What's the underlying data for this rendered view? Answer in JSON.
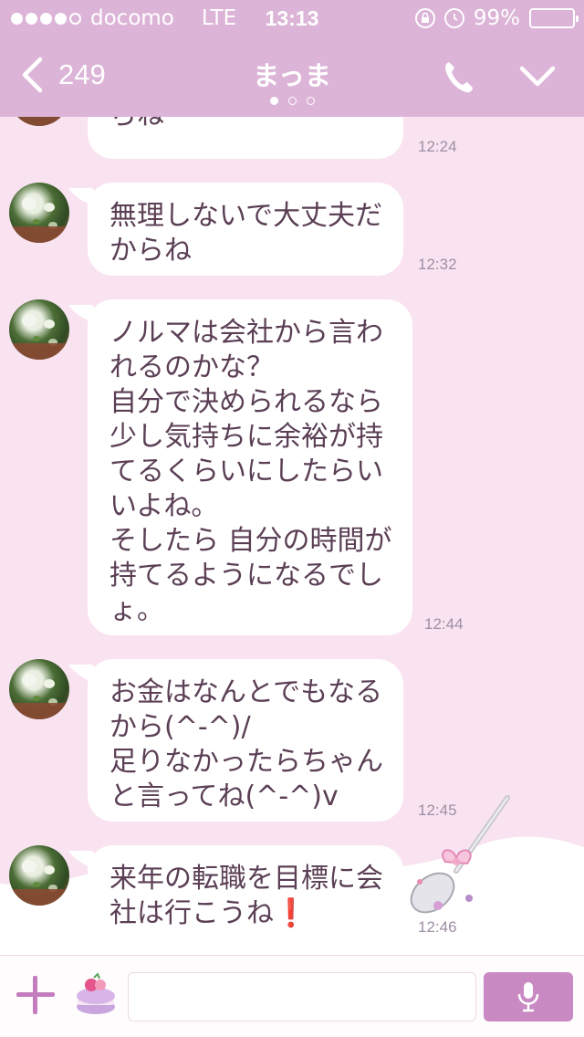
{
  "status_bar": {
    "carrier": "docomo",
    "network": "LTE",
    "time": "13:13",
    "battery": "99%",
    "battery_level": 0.99,
    "signal_bars_filled": 4,
    "signal_bars_total": 5
  },
  "header": {
    "back_count": "249",
    "title": "まっま",
    "page_count": 3,
    "active_page": 0
  },
  "messages": [
    {
      "text": "らね",
      "time": "12:24"
    },
    {
      "text": "無理しないで大丈夫だ\nからね",
      "time": "12:32"
    },
    {
      "text": "ノルマは会社から言わ\nれるのかな？\n自分で決められるなら\n少し気持ちに余裕が持\nてるくらいにしたらい\nいよね。\nそしたら 自分の時間が\n持てるようになるでし\nょ。",
      "time": "12:44"
    },
    {
      "text": "お金はなんとでもなる\nから(^-^)/\n足りなかったらちゃん\nと言ってね(^-^)v",
      "time": "12:45"
    },
    {
      "text": "来年の転職を目標に会\n社は行こうね❗",
      "time": "12:46"
    }
  ],
  "input": {
    "value": "",
    "placeholder": ""
  },
  "colors": {
    "header_bg": "#dcb4d7",
    "chat_bg": "#f9e3f1",
    "bubble_bg": "#ffffff",
    "accent": "#c98ac3"
  },
  "icons": {
    "back": "chevron-left-icon",
    "call": "phone-icon",
    "menu": "chevron-down-icon",
    "add": "plus-icon",
    "sticker": "macaron-sticker-icon",
    "voice": "microphone-icon"
  }
}
